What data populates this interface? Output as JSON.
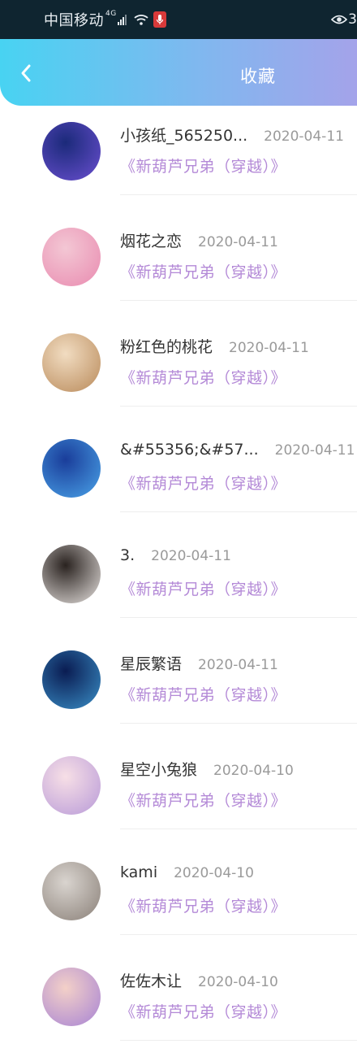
{
  "status_bar": {
    "carrier": "中国移动",
    "network": "4G",
    "right_text": "3"
  },
  "header": {
    "title": "收藏",
    "back_icon": "chevron-left-icon"
  },
  "favorites": [
    {
      "name": "小孩纸_565250...",
      "date": "2020-04-11",
      "book": "《新葫芦兄弟（穿越）》",
      "avatar_colors": [
        "#1b2a7a",
        "#6a4fd0"
      ]
    },
    {
      "name": "烟花之恋",
      "date": "2020-04-11",
      "book": "《新葫芦兄弟（穿越）》",
      "avatar_colors": [
        "#f3c7d4",
        "#e98bb0"
      ]
    },
    {
      "name": "粉红色的桃花",
      "date": "2020-04-11",
      "book": "《新葫芦兄弟（穿越）》",
      "avatar_colors": [
        "#f1dcc1",
        "#b98a5a"
      ]
    },
    {
      "name": "&#55356;&#57...",
      "date": "2020-04-11",
      "book": "《新葫芦兄弟（穿越）》",
      "avatar_colors": [
        "#1a3d9a",
        "#4aa3e8"
      ]
    },
    {
      "name": "3.",
      "date": "2020-04-11",
      "book": "《新葫芦兄弟（穿越）》",
      "avatar_colors": [
        "#2a2320",
        "#e7e2df"
      ]
    },
    {
      "name": "星辰繁语",
      "date": "2020-04-11",
      "book": "《新葫芦兄弟（穿越）》",
      "avatar_colors": [
        "#0a1c52",
        "#3a8fc7"
      ]
    },
    {
      "name": "星空小兔狼",
      "date": "2020-04-10",
      "book": "《新葫芦兄弟（穿越）》",
      "avatar_colors": [
        "#f7dfe6",
        "#b89ad8"
      ]
    },
    {
      "name": "kami",
      "date": "2020-04-10",
      "book": "《新葫芦兄弟（穿越）》",
      "avatar_colors": [
        "#d9d4cf",
        "#8a8078"
      ]
    },
    {
      "name": "佐佐木让",
      "date": "2020-04-10",
      "book": "《新葫芦兄弟（穿越）》",
      "avatar_colors": [
        "#f3d0c8",
        "#a783d4"
      ]
    }
  ]
}
